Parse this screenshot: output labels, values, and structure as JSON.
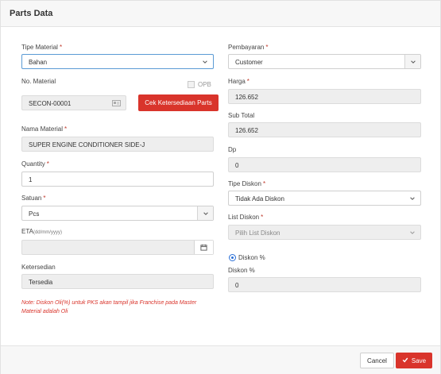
{
  "header": {
    "title": "Parts Data"
  },
  "left": {
    "tipe_material": {
      "label": "Tipe Material",
      "required": "*",
      "value": "Bahan"
    },
    "no_material": {
      "label": "No. Material",
      "value": "SECON-00001",
      "opb_label": "OPB",
      "check_button": "Cek Ketersediaan Parts"
    },
    "nama_material": {
      "label": "Nama Material",
      "required": "*",
      "value": "SUPER ENGINE CONDITIONER SIDE-J"
    },
    "quantity": {
      "label": "Quantity",
      "required": "*",
      "value": "1"
    },
    "satuan": {
      "label": "Satuan",
      "required": "*",
      "value": "Pcs"
    },
    "eta": {
      "label": "ETA",
      "hint": "(dd/mm/yyyy)",
      "value": ""
    },
    "ketersedian": {
      "label": "Ketersedian",
      "value": "Tersedia"
    },
    "note": "Note: Diskon Oli(%) untuk PKS akan tampil jika Franchise pada Master Material adalah Oli"
  },
  "right": {
    "pembayaran": {
      "label": "Pembayaran",
      "required": "*",
      "value": "Customer"
    },
    "harga": {
      "label": "Harga",
      "required": "*",
      "value": "126.652"
    },
    "sub_total": {
      "label": "Sub Total",
      "value": "126.652"
    },
    "dp": {
      "label": "Dp",
      "value": "0"
    },
    "tipe_diskon": {
      "label": "Tipe Diskon",
      "required": "*",
      "value": "Tidak Ada Diskon"
    },
    "list_diskon": {
      "label": "List Diskon",
      "required": "*",
      "placeholder": "Pilih List Diskon"
    },
    "radio_diskon": {
      "label": "Diskon %"
    },
    "diskon_pct": {
      "label": "Diskon %",
      "value": "0"
    }
  },
  "footer": {
    "cancel": "Cancel",
    "save": "Save"
  },
  "colors": {
    "accent_red": "#d9342b",
    "focus_blue": "#5b9bd5",
    "radio_blue": "#2a6fd6"
  }
}
